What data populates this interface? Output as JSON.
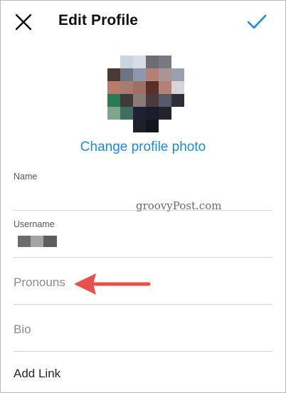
{
  "header": {
    "title": "Edit Profile",
    "close_icon": "close-icon",
    "confirm_icon": "checkmark-icon",
    "accent_color": "#1a8be0"
  },
  "avatar": {
    "description_icon": "pixelated-profile-photo"
  },
  "change_photo_label": "Change profile photo",
  "fields": {
    "name_label": "Name",
    "username_label": "Username"
  },
  "rows": {
    "pronouns": "Pronouns",
    "bio": "Bio",
    "add_link": "Add Link"
  },
  "watermark": "groovyPost.com",
  "annotation": {
    "arrow_color": "#e8504a"
  }
}
